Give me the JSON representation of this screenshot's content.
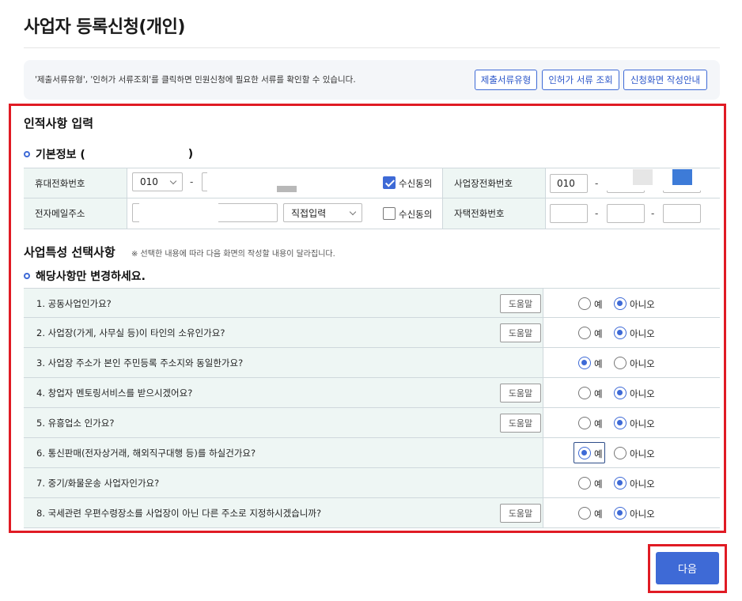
{
  "page": {
    "title": "사업자 등록신청(개인)"
  },
  "notice": {
    "text": "'제출서류유형', '인허가 서류조회'를 클릭하면 민원신청에 필요한 서류를 확인할 수 있습니다.",
    "buttons": [
      "제출서류유형",
      "인허가 서류 조회",
      "신청화면 작성안내"
    ]
  },
  "personal": {
    "section_title": "인적사항 입력",
    "basic_title": "기본정보 (",
    "basic_title_close": ")",
    "mobile_label": "휴대전화번호",
    "mobile_prefix": "010",
    "mobile_dash": "-",
    "sms_consent_label": "수신동의",
    "sms_consent_checked": true,
    "biz_phone_label": "사업장전화번호",
    "biz_phone_prefix": "010",
    "biz_dash": "-",
    "email_label": "전자메일주소",
    "email_domain_select": "직접입력",
    "email_consent_label": "수신동의",
    "email_consent_checked": false,
    "home_phone_label": "자택전화번호",
    "home_dash": "-"
  },
  "business": {
    "section_title": "사업특성 선택사항",
    "section_note": "※ 선택한 내용에 따라 다음 화면의 작성할 내용이 달라집니다.",
    "change_title": "해당사항만 변경하세요.",
    "yes_label": "예",
    "no_label": "아니오",
    "help_label": "도움말",
    "questions": [
      {
        "text": "1. 공동사업인가요?",
        "help": true,
        "answer": "no"
      },
      {
        "text": "2. 사업장(가게, 사무실 등)이 타인의 소유인가요?",
        "help": true,
        "answer": "no"
      },
      {
        "text": "3. 사업장 주소가 본인 주민등록 주소지와 동일한가요?",
        "help": false,
        "answer": "yes"
      },
      {
        "text": "4. 창업자 멘토링서비스를 받으시겠어요?",
        "help": true,
        "answer": "no"
      },
      {
        "text": "5. 유흥업소 인가요?",
        "help": true,
        "answer": "no"
      },
      {
        "text": "6. 통신판매(전자상거래, 해외직구대행 등)를 하실건가요?",
        "help": false,
        "answer": "yes"
      },
      {
        "text": "7. 중기/화물운송 사업자인가요?",
        "help": false,
        "answer": "no"
      },
      {
        "text": "8. 국세관련 우편수령장소를 사업장이 아닌 다른 주소로 지정하시겠습니까?",
        "help": true,
        "answer": "no"
      }
    ]
  },
  "footer": {
    "next_label": "다음"
  },
  "colors": {
    "accent": "#3e6ad6",
    "highlight_frame": "#e01b24",
    "label_bg": "#eef6f4"
  }
}
